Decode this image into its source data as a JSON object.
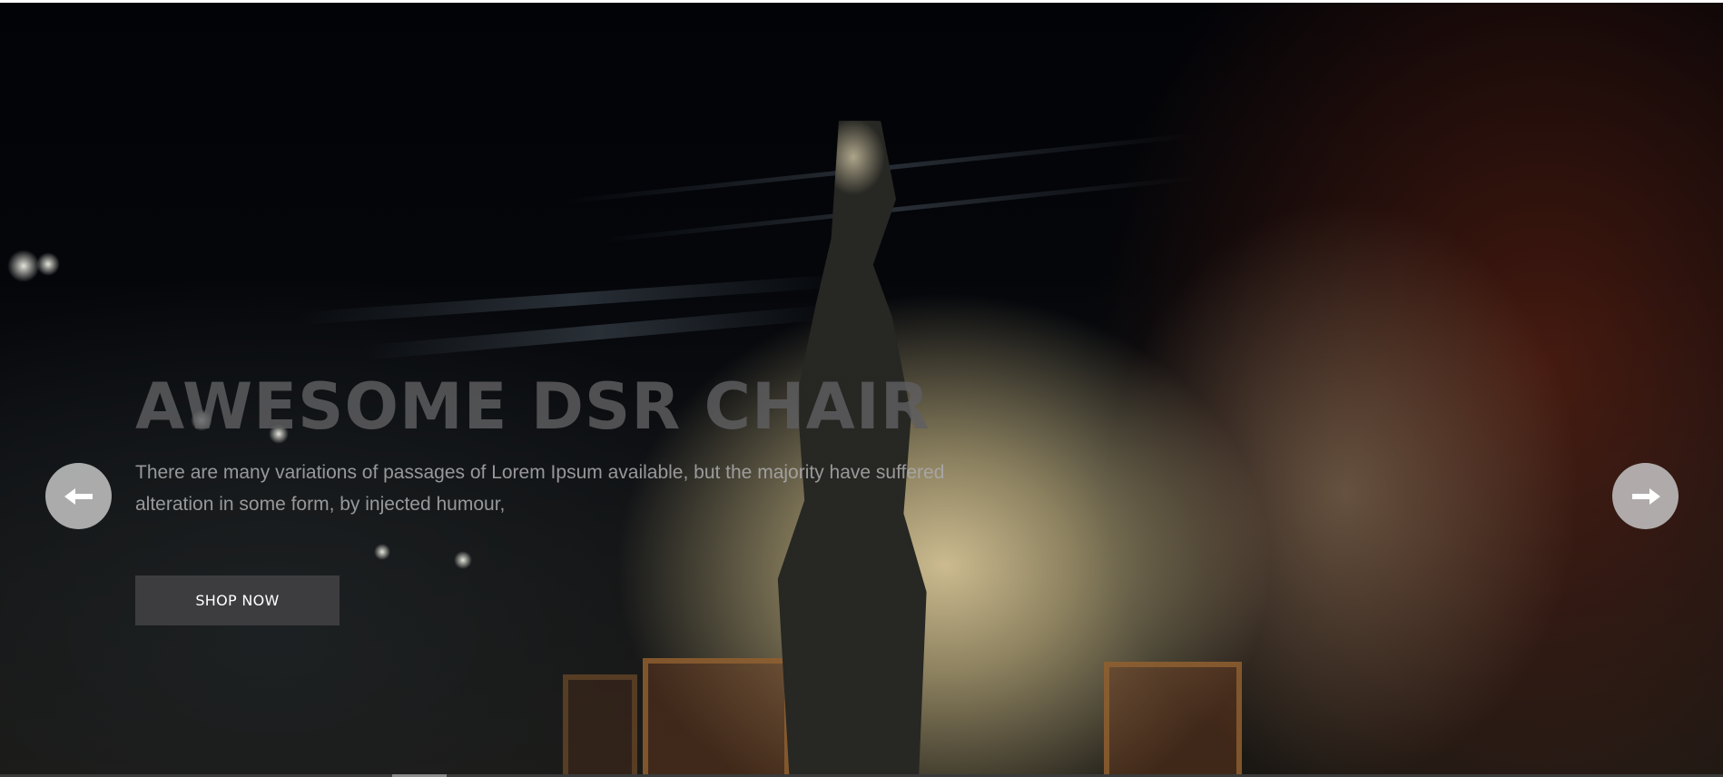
{
  "hero": {
    "title": "AWESOME DSR CHAIR",
    "description": "There are many variations of passages of Lorem Ipsum available, but the majority have suffered alteration in some form, by injected humour,",
    "button_label": "SHOP NOW"
  },
  "slider": {
    "prev_icon": "arrow-left-icon",
    "next_icon": "arrow-right-icon"
  },
  "colors": {
    "button_bg": "#3d3d3f",
    "arrow_bg": "#c6c6c6",
    "title_color": "#5f5f61"
  }
}
